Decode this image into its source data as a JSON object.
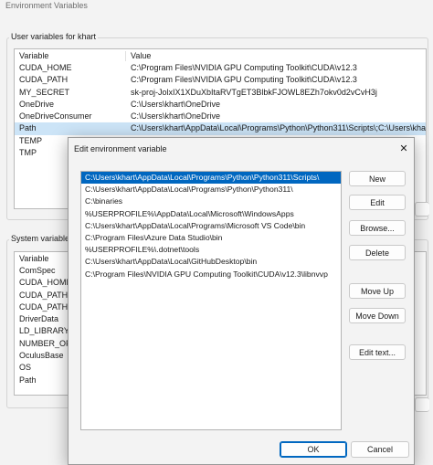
{
  "window": {
    "title": "Environment Variables",
    "user_group_label": "User variables for khart",
    "system_group_label": "System variables",
    "columns": {
      "variable": "Variable",
      "value": "Value"
    },
    "user_vars": [
      {
        "name": "CUDA_HOME",
        "value": "C:\\Program Files\\NVIDIA GPU Computing Toolkit\\CUDA\\v12.3"
      },
      {
        "name": "CUDA_PATH",
        "value": "C:\\Program Files\\NVIDIA GPU Computing Toolkit\\CUDA\\v12.3"
      },
      {
        "name": "MY_SECRET",
        "value": "sk-proj-JolxIX1XDuXbItaRVTgET3BlbkFJOWL8EZh7okv0d2vCvH3j"
      },
      {
        "name": "OneDrive",
        "value": "C:\\Users\\khart\\OneDrive"
      },
      {
        "name": "OneDriveConsumer",
        "value": "C:\\Users\\khart\\OneDrive"
      },
      {
        "name": "Path",
        "value": "C:\\Users\\khart\\AppData\\Local\\Programs\\Python\\Python311\\Scripts\\;C:\\Users\\khart"
      },
      {
        "name": "TEMP",
        "value": ""
      },
      {
        "name": "TMP",
        "value": ""
      }
    ],
    "system_vars": [
      {
        "name": "ComSpec"
      },
      {
        "name": "CUDA_HOME"
      },
      {
        "name": "CUDA_PATH"
      },
      {
        "name": "CUDA_PATH_V"
      },
      {
        "name": "DriverData"
      },
      {
        "name": "LD_LIBRARY_P"
      },
      {
        "name": "NUMBER_OF_"
      },
      {
        "name": "OculusBase"
      },
      {
        "name": "OS"
      },
      {
        "name": "Path"
      }
    ]
  },
  "dialog": {
    "title": "Edit environment variable",
    "close_glyph": "✕",
    "paths": [
      "C:\\Users\\khart\\AppData\\Local\\Programs\\Python\\Python311\\Scripts\\",
      "C:\\Users\\khart\\AppData\\Local\\Programs\\Python\\Python311\\",
      "C:\\binaries",
      "%USERPROFILE%\\AppData\\Local\\Microsoft\\WindowsApps",
      "C:\\Users\\khart\\AppData\\Local\\Programs\\Microsoft VS Code\\bin",
      "C:\\Program Files\\Azure Data Studio\\bin",
      "%USERPROFILE%\\.dotnet\\tools",
      "C:\\Users\\khart\\AppData\\Local\\GitHubDesktop\\bin",
      "C:\\Program Files\\NVIDIA GPU Computing Toolkit\\CUDA\\v12.3\\libnvvp"
    ],
    "selected_index": 0,
    "buttons": {
      "new": "New",
      "edit": "Edit",
      "browse": "Browse...",
      "delete": "Delete",
      "move_up": "Move Up",
      "move_down": "Move Down",
      "edit_text": "Edit text...",
      "ok": "OK",
      "cancel": "Cancel"
    }
  },
  "colors": {
    "selection": "#0067c0",
    "row_highlight": "#cce4f7"
  }
}
